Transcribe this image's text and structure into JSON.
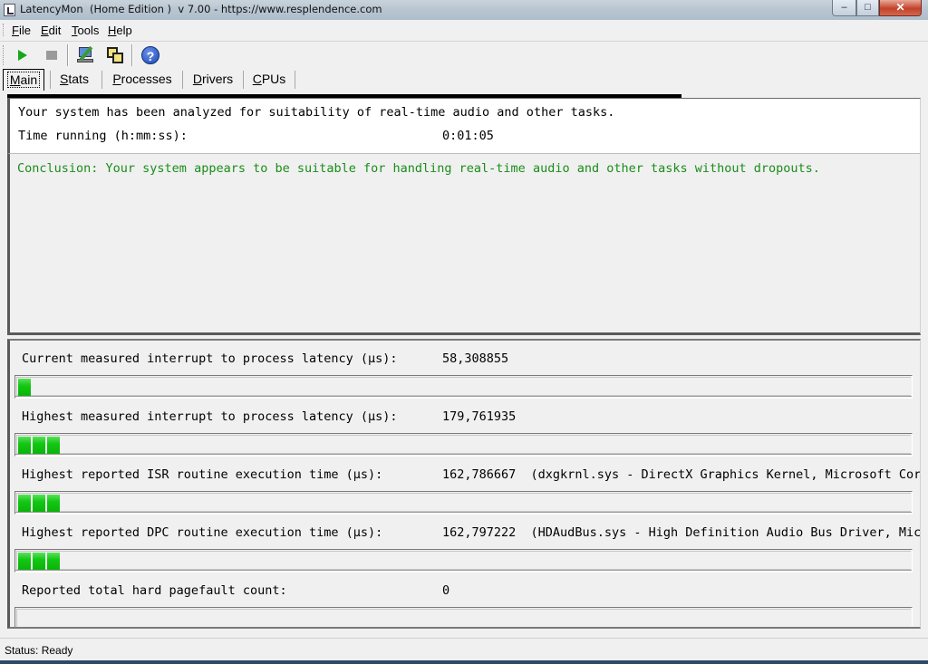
{
  "window": {
    "title": "LatencyMon  (Home Edition )  v 7.00 - https://www.resplendence.com",
    "minimize_glyph": "‒",
    "maximize_glyph": "□",
    "close_glyph": "✕"
  },
  "menu": [
    {
      "accel": "F",
      "rest": "ile"
    },
    {
      "accel": "E",
      "rest": "dit"
    },
    {
      "accel": "T",
      "rest": "ools"
    },
    {
      "accel": "H",
      "rest": "elp"
    }
  ],
  "toolbar": {
    "icons": [
      "play-icon",
      "stop-icon",
      "computer-analyze-icon",
      "copy-icon",
      "help-icon"
    ],
    "help_glyph": "?"
  },
  "tabs": [
    {
      "accel": "M",
      "rest": "ain",
      "active": true
    },
    {
      "accel": "S",
      "rest": "tats",
      "active": false
    },
    {
      "accel": "P",
      "rest": "rocesses",
      "active": false
    },
    {
      "accel": "D",
      "rest": "rivers",
      "active": false
    },
    {
      "accel": "C",
      "rest": "PUs",
      "active": false
    }
  ],
  "summary": {
    "analysis_text": "Your system has been analyzed for suitability of real-time audio and other tasks.",
    "time_label": "Time running (h:mm:ss):",
    "time_value": "0:01:05"
  },
  "conclusion": "Conclusion: Your system appears to be suitable for handling real-time audio and other tasks without dropouts.",
  "stats": [
    {
      "label": "Current measured interrupt to process latency (µs):",
      "value": "58,308855",
      "detail": "",
      "bar_segments": 1
    },
    {
      "label": "Highest measured interrupt to process latency (µs):",
      "value": "179,761935",
      "detail": "",
      "bar_segments": 3
    },
    {
      "label": "Highest reported ISR routine execution time (µs):",
      "value": "162,786667",
      "detail": "(dxgkrnl.sys - DirectX Graphics Kernel, Microsoft Cor",
      "bar_segments": 3
    },
    {
      "label": "Highest reported DPC routine execution time (µs):",
      "value": "162,797222",
      "detail": "(HDAudBus.sys - High Definition Audio Bus Driver, Mic",
      "bar_segments": 3
    },
    {
      "label": "Reported total hard pagefault count:",
      "value": "0",
      "detail": "",
      "bar_segments": 0
    }
  ],
  "status": "Status: Ready",
  "colors": {
    "conclusion_text": "#1a8d1a",
    "bar_fill": "#14c814",
    "play_icon": "#17a717"
  }
}
